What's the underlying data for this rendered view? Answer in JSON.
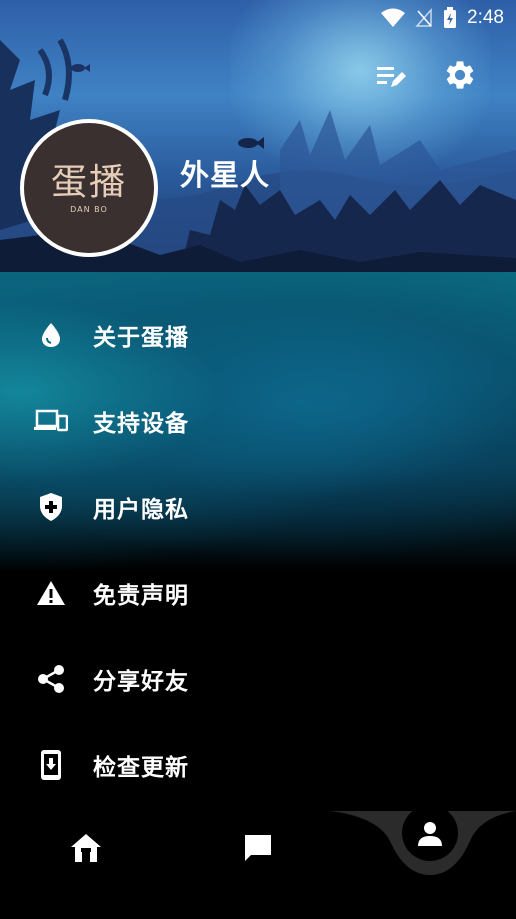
{
  "status_bar": {
    "time": "2:48",
    "icons": [
      "wifi-icon",
      "signal-icon",
      "battery-charging-icon"
    ]
  },
  "header": {
    "username": "外星人",
    "logo": {
      "chinese": "蛋播",
      "english": "DAN BO"
    },
    "actions": [
      "edit-list-icon",
      "gear-icon"
    ]
  },
  "menu": {
    "items": [
      {
        "label": "关于蛋播",
        "icon": "egg-icon"
      },
      {
        "label": "支持设备",
        "icon": "devices-icon"
      },
      {
        "label": "用户隐私",
        "icon": "shield-icon"
      },
      {
        "label": "免责声明",
        "icon": "warning-icon"
      },
      {
        "label": "分享好友",
        "icon": "share-icon"
      },
      {
        "label": "检查更新",
        "icon": "phone-download-icon"
      }
    ]
  },
  "bottom_nav": {
    "items": [
      "home-icon",
      "chat-icon",
      "person-icon"
    ],
    "active": "person-icon"
  },
  "colors": {
    "accent_teal": "#0b6b80",
    "avatar_bg": "#3a302f",
    "logo_text": "#e6cdb8"
  }
}
